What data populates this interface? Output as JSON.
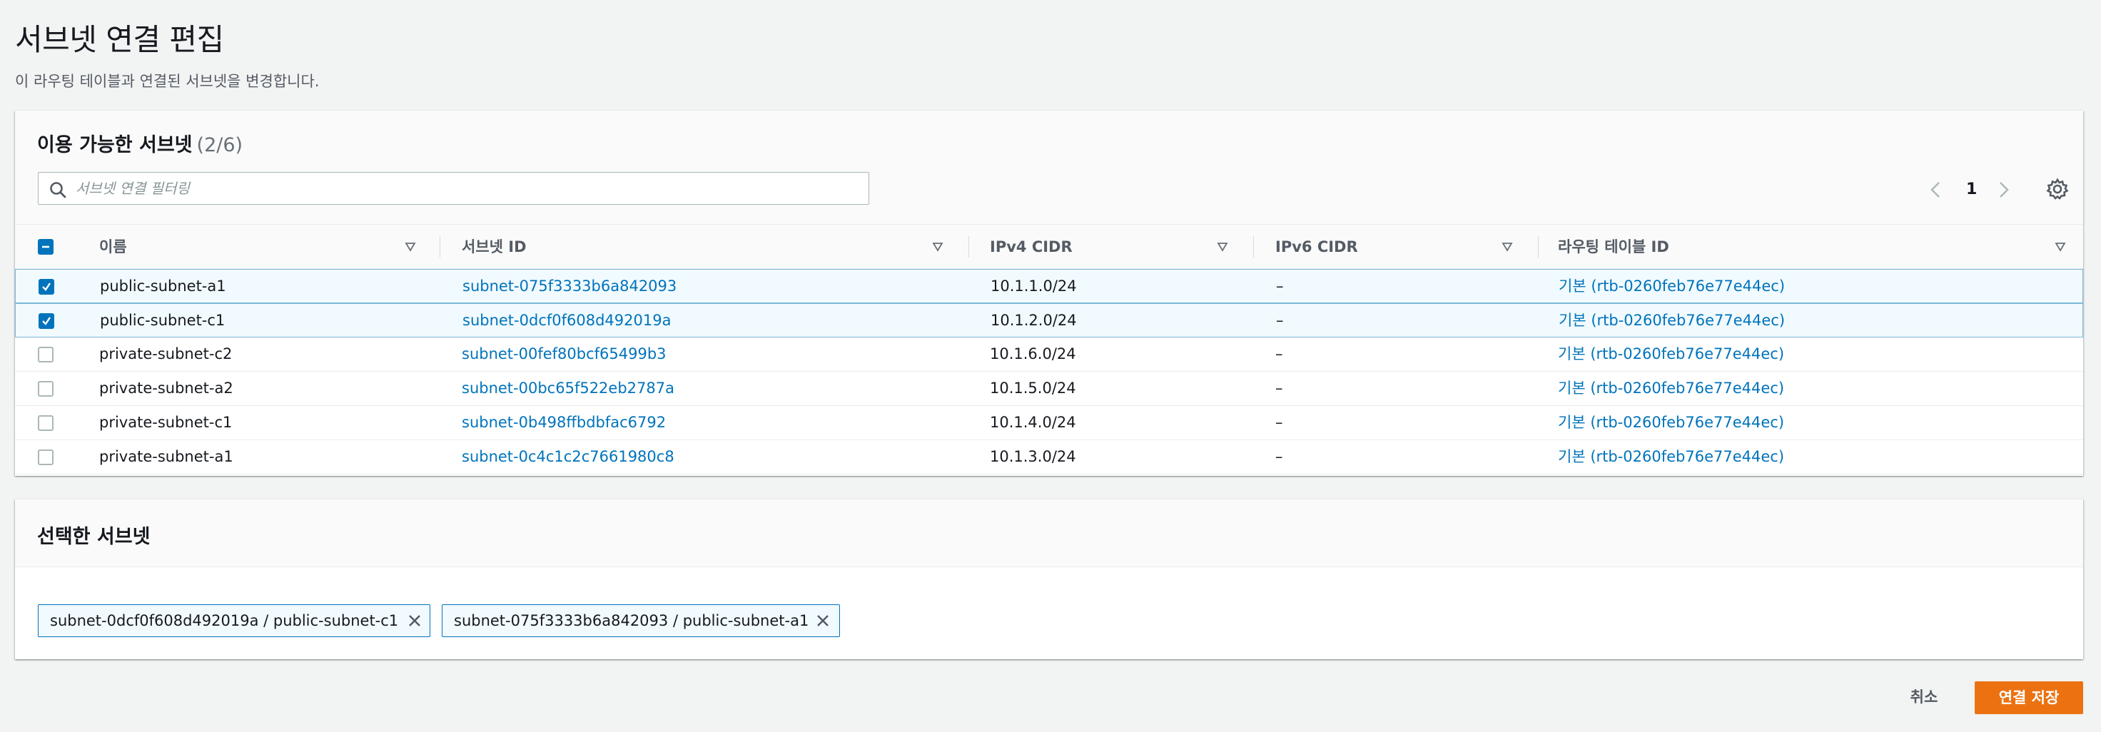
{
  "page": {
    "title": "서브넷 연결 편집",
    "description": "이 라우팅 테이블과 연결된 서브넷을 변경합니다."
  },
  "available": {
    "title": "이용 가능한 서브넷",
    "count": "(2/6)",
    "search_placeholder": "서브넷 연결 필터링",
    "page_number": "1",
    "columns": [
      "이름",
      "서브넷 ID",
      "IPv4 CIDR",
      "IPv6 CIDR",
      "라우팅 테이블 ID"
    ],
    "rows": [
      {
        "checked": true,
        "name": "public-subnet-a1",
        "subnet_id": "subnet-075f3333b6a842093",
        "ipv4": "10.1.1.0/24",
        "ipv6": "–",
        "route_table": "기본 (rtb-0260feb76e77e44ec)"
      },
      {
        "checked": true,
        "name": "public-subnet-c1",
        "subnet_id": "subnet-0dcf0f608d492019a",
        "ipv4": "10.1.2.0/24",
        "ipv6": "–",
        "route_table": "기본 (rtb-0260feb76e77e44ec)"
      },
      {
        "checked": false,
        "name": "private-subnet-c2",
        "subnet_id": "subnet-00fef80bcf65499b3",
        "ipv4": "10.1.6.0/24",
        "ipv6": "–",
        "route_table": "기본 (rtb-0260feb76e77e44ec)"
      },
      {
        "checked": false,
        "name": "private-subnet-a2",
        "subnet_id": "subnet-00bc65f522eb2787a",
        "ipv4": "10.1.5.0/24",
        "ipv6": "–",
        "route_table": "기본 (rtb-0260feb76e77e44ec)"
      },
      {
        "checked": false,
        "name": "private-subnet-c1",
        "subnet_id": "subnet-0b498ffbdbfac6792",
        "ipv4": "10.1.4.0/24",
        "ipv6": "–",
        "route_table": "기본 (rtb-0260feb76e77e44ec)"
      },
      {
        "checked": false,
        "name": "private-subnet-a1",
        "subnet_id": "subnet-0c4c1c2c7661980c8",
        "ipv4": "10.1.3.0/24",
        "ipv6": "–",
        "route_table": "기본 (rtb-0260feb76e77e44ec)"
      }
    ]
  },
  "selected": {
    "title": "선택한 서브넷",
    "tokens": [
      "subnet-0dcf0f608d492019a / public-subnet-c1",
      "subnet-075f3333b6a842093 / public-subnet-a1"
    ]
  },
  "footer": {
    "cancel_label": "취소",
    "save_label": "연결 저장"
  },
  "colors": {
    "accent": "#0073bb",
    "primary_button": "#ec7211",
    "selected_row_bg": "#f1faff"
  },
  "icons": [
    "search-icon",
    "chevron-left-icon",
    "chevron-right-icon",
    "gear-icon",
    "sort-triangle-icon",
    "checkbox-indeterminate-icon",
    "checkmark-icon",
    "close-icon"
  ]
}
